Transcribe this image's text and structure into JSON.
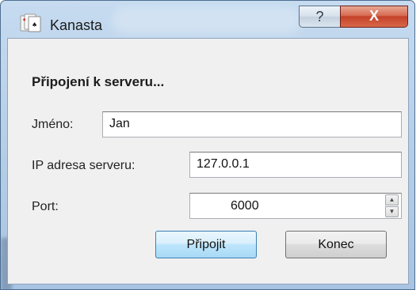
{
  "window": {
    "title": "Kanasta",
    "help_glyph": "?",
    "close_glyph": "X",
    "app_icon": "cards-icon"
  },
  "dialog": {
    "heading": "Připojení k serveru...",
    "name_label": "Jméno:",
    "name_value": "Jan",
    "ip_label": "IP adresa serveru:",
    "ip_value": "127.0.0.1",
    "port_label": "Port:",
    "port_value": "6000",
    "connect_label": "Připojit",
    "quit_label": "Konec"
  }
}
